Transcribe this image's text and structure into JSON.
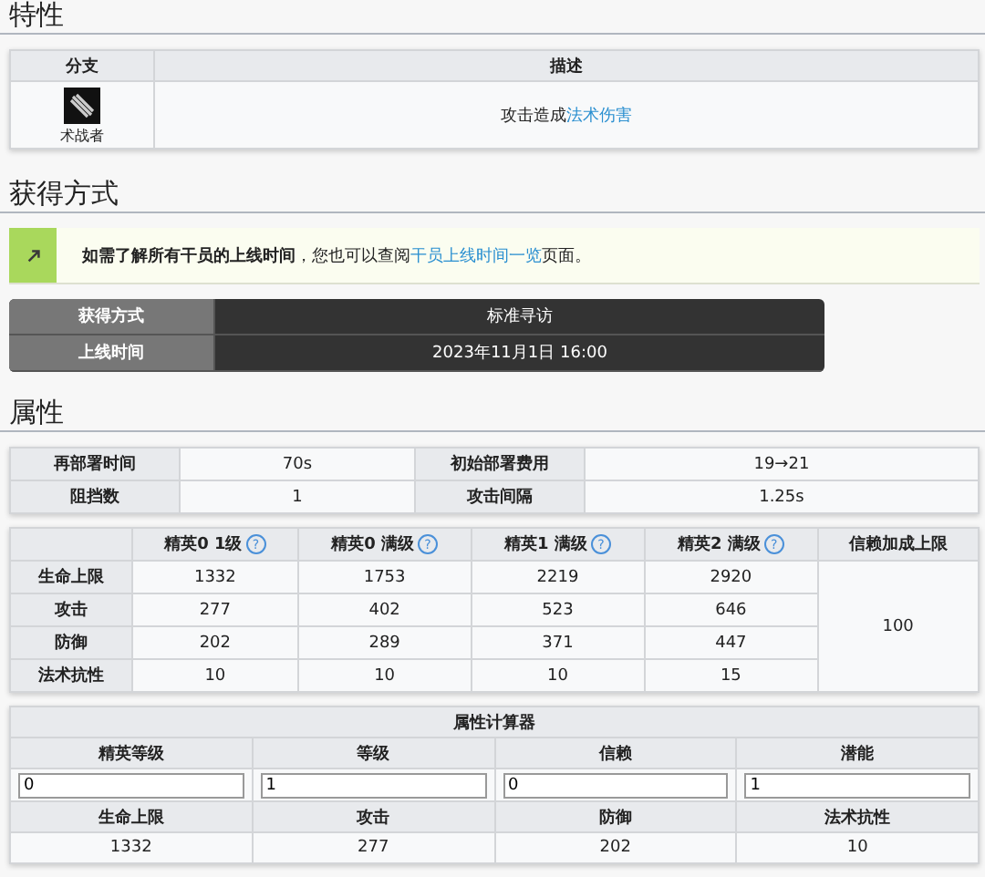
{
  "trait": {
    "heading": "特性",
    "columns": [
      "分支",
      "描述"
    ],
    "branch": "术战者",
    "description": "攻击造成",
    "description_link": "法术伤害"
  },
  "acquire": {
    "heading": "获得方式",
    "notice": {
      "text": "**如需了解所有干员的上线时间**，您也可以查阅",
      "link": "干员上线时间一览",
      "after": "页面。"
    },
    "rows": [
      {
        "label": "获得方式",
        "value": "标准寻访"
      },
      {
        "label": "上线时间",
        "value": "2023年11月1日 16:00"
      }
    ]
  },
  "attributes": {
    "heading": "属性",
    "basic": [
      {
        "label": "再部署时间",
        "value": "70s"
      },
      {
        "label": "初始部署费用",
        "value": "19→21"
      },
      {
        "label": "阻挡数",
        "value": "1"
      },
      {
        "label": "攻击间隔",
        "value": "1.25s"
      }
    ],
    "stats": {
      "columns": [
        {
          "label": "精英0 1级",
          "help": "?"
        },
        {
          "label": "精英0 满级",
          "help": "?"
        },
        {
          "label": "精英1 满级",
          "help": "?"
        },
        {
          "label": "精英2 满级",
          "help": "?"
        },
        {
          "label": "信赖加成上限"
        }
      ],
      "rows": [
        {
          "label": "生命上限",
          "values": [
            "1332",
            "1753",
            "2219",
            "2920"
          ]
        },
        {
          "label": "攻击",
          "values": [
            "277",
            "402",
            "523",
            "646"
          ]
        },
        {
          "label": "防御",
          "values": [
            "202",
            "289",
            "371",
            "447"
          ]
        },
        {
          "label": "法术抗性",
          "values": [
            "10",
            "10",
            "10",
            "15"
          ]
        }
      ],
      "trust_bonus": "100"
    },
    "calculator": {
      "title": "属性计算器",
      "inputs": [
        {
          "label": "精英等级",
          "value": "0"
        },
        {
          "label": "等级",
          "value": "1"
        },
        {
          "label": "信赖",
          "value": "0"
        },
        {
          "label": "潜能",
          "value": "1"
        }
      ],
      "results": [
        {
          "label": "生命上限",
          "value": "1332"
        },
        {
          "label": "攻击",
          "value": "277"
        },
        {
          "label": "防御",
          "value": "202"
        },
        {
          "label": "法术抗性",
          "value": "10"
        }
      ]
    }
  }
}
